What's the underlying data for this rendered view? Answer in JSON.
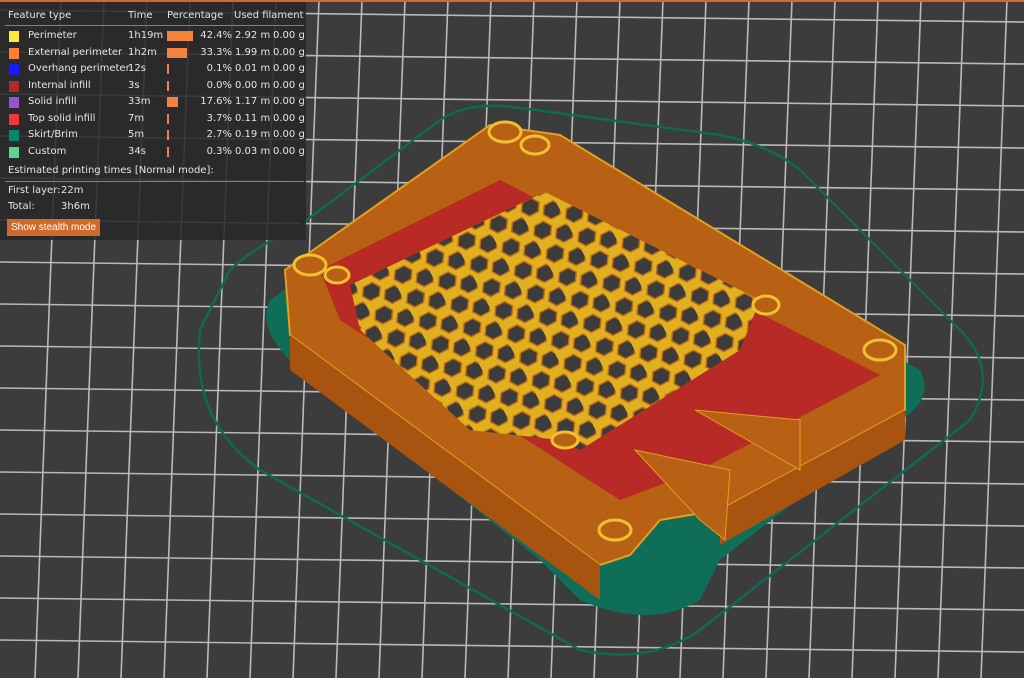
{
  "legend": {
    "headers": {
      "feature": "Feature type",
      "time": "Time",
      "percentage": "Percentage",
      "filament": "Used filament"
    },
    "rows": [
      {
        "name": "Perimeter",
        "color": "#ffe83a",
        "time": "1h19m",
        "percent": "42.4%",
        "pct": 42.4,
        "length": "2.92 m",
        "weight": "0.00 g"
      },
      {
        "name": "External perimeter",
        "color": "#ff8030",
        "time": "1h2m",
        "percent": "33.3%",
        "pct": 33.3,
        "length": "1.99 m",
        "weight": "0.00 g"
      },
      {
        "name": "Overhang perimeter",
        "color": "#1a1aff",
        "time": "12s",
        "percent": "0.1%",
        "pct": 0.1,
        "length": "0.01 m",
        "weight": "0.00 g"
      },
      {
        "name": "Internal infill",
        "color": "#b02a2a",
        "time": "3s",
        "percent": "0.0%",
        "pct": 0.0,
        "length": "0.00 m",
        "weight": "0.00 g"
      },
      {
        "name": "Solid infill",
        "color": "#9654cc",
        "time": "33m",
        "percent": "17.6%",
        "pct": 17.6,
        "length": "1.17 m",
        "weight": "0.00 g"
      },
      {
        "name": "Top solid infill",
        "color": "#f0383c",
        "time": "7m",
        "percent": "3.7%",
        "pct": 3.7,
        "length": "0.11 m",
        "weight": "0.00 g"
      },
      {
        "name": "Skirt/Brim",
        "color": "#00876e",
        "time": "5m",
        "percent": "2.7%",
        "pct": 2.7,
        "length": "0.19 m",
        "weight": "0.00 g"
      },
      {
        "name": "Custom",
        "color": "#5ed38c",
        "time": "34s",
        "percent": "0.3%",
        "pct": 0.3,
        "length": "0.03 m",
        "weight": "0.00 g"
      }
    ],
    "estimated_title": "Estimated printing times [Normal mode]:",
    "first_layer_label": "First layer:",
    "first_layer_value": "22m",
    "total_label": "Total:",
    "total_value": "3h6m",
    "stealth_button": "Show stealth mode"
  }
}
